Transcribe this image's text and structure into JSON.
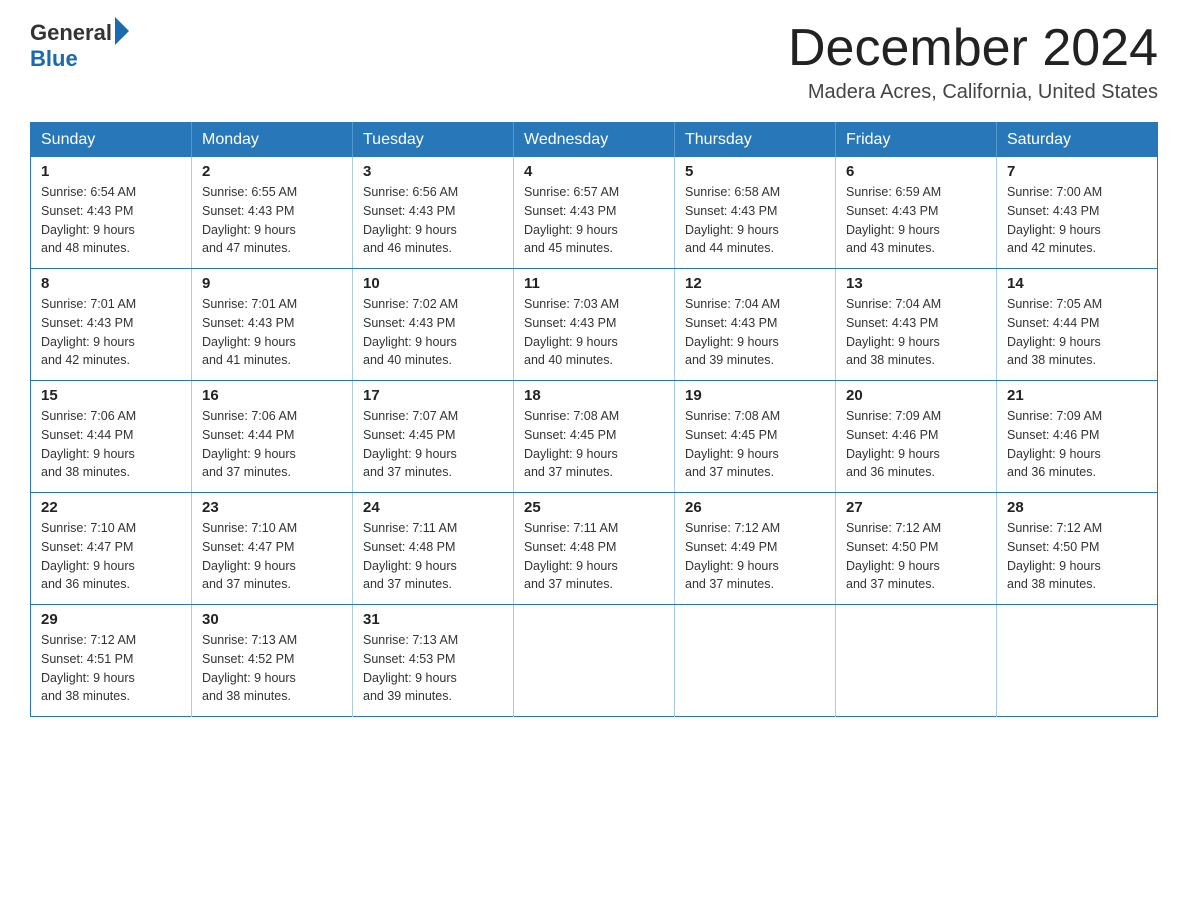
{
  "logo": {
    "text_general": "General",
    "text_blue": "Blue",
    "triangle_color": "#1a6aad"
  },
  "header": {
    "month_year": "December 2024",
    "location": "Madera Acres, California, United States"
  },
  "days_of_week": [
    "Sunday",
    "Monday",
    "Tuesday",
    "Wednesday",
    "Thursday",
    "Friday",
    "Saturday"
  ],
  "weeks": [
    [
      {
        "day": "1",
        "sunrise": "6:54 AM",
        "sunset": "4:43 PM",
        "daylight": "9 hours and 48 minutes."
      },
      {
        "day": "2",
        "sunrise": "6:55 AM",
        "sunset": "4:43 PM",
        "daylight": "9 hours and 47 minutes."
      },
      {
        "day": "3",
        "sunrise": "6:56 AM",
        "sunset": "4:43 PM",
        "daylight": "9 hours and 46 minutes."
      },
      {
        "day": "4",
        "sunrise": "6:57 AM",
        "sunset": "4:43 PM",
        "daylight": "9 hours and 45 minutes."
      },
      {
        "day": "5",
        "sunrise": "6:58 AM",
        "sunset": "4:43 PM",
        "daylight": "9 hours and 44 minutes."
      },
      {
        "day": "6",
        "sunrise": "6:59 AM",
        "sunset": "4:43 PM",
        "daylight": "9 hours and 43 minutes."
      },
      {
        "day": "7",
        "sunrise": "7:00 AM",
        "sunset": "4:43 PM",
        "daylight": "9 hours and 42 minutes."
      }
    ],
    [
      {
        "day": "8",
        "sunrise": "7:01 AM",
        "sunset": "4:43 PM",
        "daylight": "9 hours and 42 minutes."
      },
      {
        "day": "9",
        "sunrise": "7:01 AM",
        "sunset": "4:43 PM",
        "daylight": "9 hours and 41 minutes."
      },
      {
        "day": "10",
        "sunrise": "7:02 AM",
        "sunset": "4:43 PM",
        "daylight": "9 hours and 40 minutes."
      },
      {
        "day": "11",
        "sunrise": "7:03 AM",
        "sunset": "4:43 PM",
        "daylight": "9 hours and 40 minutes."
      },
      {
        "day": "12",
        "sunrise": "7:04 AM",
        "sunset": "4:43 PM",
        "daylight": "9 hours and 39 minutes."
      },
      {
        "day": "13",
        "sunrise": "7:04 AM",
        "sunset": "4:43 PM",
        "daylight": "9 hours and 38 minutes."
      },
      {
        "day": "14",
        "sunrise": "7:05 AM",
        "sunset": "4:44 PM",
        "daylight": "9 hours and 38 minutes."
      }
    ],
    [
      {
        "day": "15",
        "sunrise": "7:06 AM",
        "sunset": "4:44 PM",
        "daylight": "9 hours and 38 minutes."
      },
      {
        "day": "16",
        "sunrise": "7:06 AM",
        "sunset": "4:44 PM",
        "daylight": "9 hours and 37 minutes."
      },
      {
        "day": "17",
        "sunrise": "7:07 AM",
        "sunset": "4:45 PM",
        "daylight": "9 hours and 37 minutes."
      },
      {
        "day": "18",
        "sunrise": "7:08 AM",
        "sunset": "4:45 PM",
        "daylight": "9 hours and 37 minutes."
      },
      {
        "day": "19",
        "sunrise": "7:08 AM",
        "sunset": "4:45 PM",
        "daylight": "9 hours and 37 minutes."
      },
      {
        "day": "20",
        "sunrise": "7:09 AM",
        "sunset": "4:46 PM",
        "daylight": "9 hours and 36 minutes."
      },
      {
        "day": "21",
        "sunrise": "7:09 AM",
        "sunset": "4:46 PM",
        "daylight": "9 hours and 36 minutes."
      }
    ],
    [
      {
        "day": "22",
        "sunrise": "7:10 AM",
        "sunset": "4:47 PM",
        "daylight": "9 hours and 36 minutes."
      },
      {
        "day": "23",
        "sunrise": "7:10 AM",
        "sunset": "4:47 PM",
        "daylight": "9 hours and 37 minutes."
      },
      {
        "day": "24",
        "sunrise": "7:11 AM",
        "sunset": "4:48 PM",
        "daylight": "9 hours and 37 minutes."
      },
      {
        "day": "25",
        "sunrise": "7:11 AM",
        "sunset": "4:48 PM",
        "daylight": "9 hours and 37 minutes."
      },
      {
        "day": "26",
        "sunrise": "7:12 AM",
        "sunset": "4:49 PM",
        "daylight": "9 hours and 37 minutes."
      },
      {
        "day": "27",
        "sunrise": "7:12 AM",
        "sunset": "4:50 PM",
        "daylight": "9 hours and 37 minutes."
      },
      {
        "day": "28",
        "sunrise": "7:12 AM",
        "sunset": "4:50 PM",
        "daylight": "9 hours and 38 minutes."
      }
    ],
    [
      {
        "day": "29",
        "sunrise": "7:12 AM",
        "sunset": "4:51 PM",
        "daylight": "9 hours and 38 minutes."
      },
      {
        "day": "30",
        "sunrise": "7:13 AM",
        "sunset": "4:52 PM",
        "daylight": "9 hours and 38 minutes."
      },
      {
        "day": "31",
        "sunrise": "7:13 AM",
        "sunset": "4:53 PM",
        "daylight": "9 hours and 39 minutes."
      },
      null,
      null,
      null,
      null
    ]
  ],
  "labels": {
    "sunrise_prefix": "Sunrise: ",
    "sunset_prefix": "Sunset: ",
    "daylight_prefix": "Daylight: "
  }
}
